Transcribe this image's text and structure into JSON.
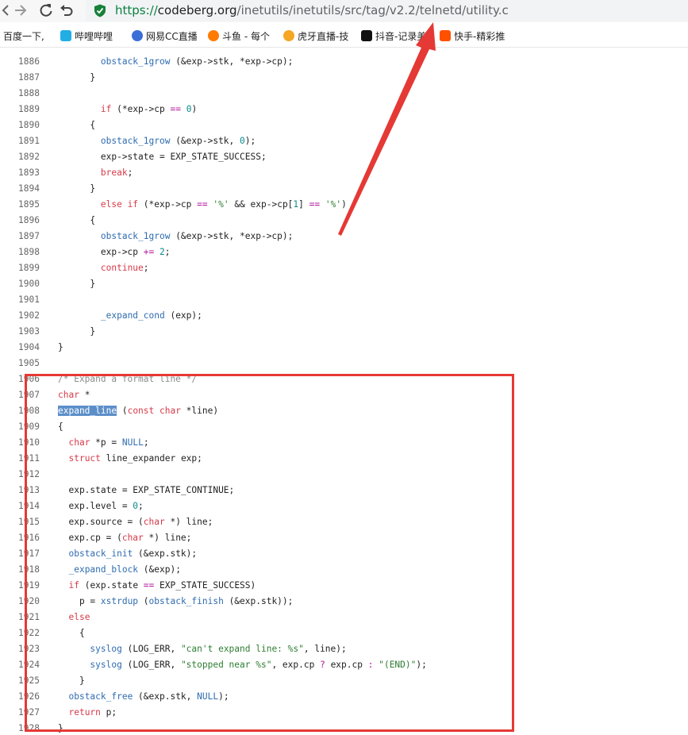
{
  "browser": {
    "url_scheme": "https://",
    "url_host": "codeberg.org",
    "url_path": "/inetutils/inetutils/src/tag/v2.2/telnetd/utility.c"
  },
  "bookmarks": [
    {
      "label": "百度一下,",
      "color": ""
    },
    {
      "label": "哔哩哔哩",
      "color": "#23ade5"
    },
    {
      "label": "网易CC直播",
      "color": "#3b6fd8"
    },
    {
      "label": "斗鱼 - 每个",
      "color": "#ff7a00"
    },
    {
      "label": "虎牙直播-技",
      "color": "#f5a623"
    },
    {
      "label": "抖音-记录美",
      "color": "#111111"
    },
    {
      "label": "快手-精彩推",
      "color": "#ff5000"
    }
  ],
  "code_lines": [
    {
      "n": "1886",
      "tokens": [
        [
          "        "
        ],
        [
          "obstack_1grow",
          "fn"
        ],
        [
          " (&exp->stk, *exp->cp);"
        ]
      ]
    },
    {
      "n": "1887",
      "tokens": [
        [
          "      }"
        ]
      ]
    },
    {
      "n": "1888",
      "tokens": [
        [
          ""
        ]
      ]
    },
    {
      "n": "1889",
      "tokens": [
        [
          "        "
        ],
        [
          "if",
          "kw"
        ],
        [
          " (*exp->cp "
        ],
        [
          "==",
          "op"
        ],
        [
          " "
        ],
        [
          "0",
          "num"
        ],
        [
          ")"
        ]
      ]
    },
    {
      "n": "1890",
      "tokens": [
        [
          "      {"
        ]
      ]
    },
    {
      "n": "1891",
      "tokens": [
        [
          "        "
        ],
        [
          "obstack_1grow",
          "fn"
        ],
        [
          " (&exp->stk, "
        ],
        [
          "0",
          "num"
        ],
        [
          ");"
        ]
      ]
    },
    {
      "n": "1892",
      "tokens": [
        [
          "        exp->state = EXP_STATE_SUCCESS;"
        ]
      ]
    },
    {
      "n": "1893",
      "tokens": [
        [
          "        "
        ],
        [
          "break",
          "kw"
        ],
        [
          ";"
        ]
      ]
    },
    {
      "n": "1894",
      "tokens": [
        [
          "      }"
        ]
      ]
    },
    {
      "n": "1895",
      "tokens": [
        [
          "        "
        ],
        [
          "else if",
          "kw"
        ],
        [
          " (*exp->cp "
        ],
        [
          "==",
          "op"
        ],
        [
          " "
        ],
        [
          "'%'",
          "str"
        ],
        [
          " && exp->cp["
        ],
        [
          "1",
          "num"
        ],
        [
          "] "
        ],
        [
          "==",
          "op"
        ],
        [
          " "
        ],
        [
          "'%'",
          "str"
        ],
        [
          ")"
        ]
      ]
    },
    {
      "n": "1896",
      "tokens": [
        [
          "      {"
        ]
      ]
    },
    {
      "n": "1897",
      "tokens": [
        [
          "        "
        ],
        [
          "obstack_1grow",
          "fn"
        ],
        [
          " (&exp->stk, *exp->cp);"
        ]
      ]
    },
    {
      "n": "1898",
      "tokens": [
        [
          "        exp->cp "
        ],
        [
          "+=",
          "op"
        ],
        [
          " "
        ],
        [
          "2",
          "num"
        ],
        [
          ";"
        ]
      ]
    },
    {
      "n": "1899",
      "tokens": [
        [
          "        "
        ],
        [
          "continue",
          "kw"
        ],
        [
          ";"
        ]
      ]
    },
    {
      "n": "1900",
      "tokens": [
        [
          "      }"
        ]
      ]
    },
    {
      "n": "1901",
      "tokens": [
        [
          ""
        ]
      ]
    },
    {
      "n": "1902",
      "tokens": [
        [
          "        "
        ],
        [
          "_expand_cond",
          "fn"
        ],
        [
          " (exp);"
        ]
      ]
    },
    {
      "n": "1903",
      "tokens": [
        [
          "      }"
        ]
      ]
    },
    {
      "n": "1904",
      "tokens": [
        [
          "}"
        ]
      ]
    },
    {
      "n": "1905",
      "tokens": [
        [
          ""
        ]
      ]
    },
    {
      "n": "1906",
      "tokens": [
        [
          "/* Expand a format line */",
          "cm"
        ]
      ]
    },
    {
      "n": "1907",
      "tokens": [
        [
          "char",
          "kw"
        ],
        [
          " *"
        ]
      ]
    },
    {
      "n": "1908",
      "tokens": [
        [
          "expand_line",
          "hl"
        ],
        [
          " ("
        ],
        [
          "const char",
          "kw"
        ],
        [
          " *line)"
        ]
      ]
    },
    {
      "n": "1909",
      "tokens": [
        [
          "{"
        ]
      ]
    },
    {
      "n": "1910",
      "tokens": [
        [
          "  "
        ],
        [
          "char",
          "kw"
        ],
        [
          " *p = "
        ],
        [
          "NULL",
          "fn"
        ],
        [
          ";"
        ]
      ]
    },
    {
      "n": "1911",
      "tokens": [
        [
          "  "
        ],
        [
          "struct",
          "kw"
        ],
        [
          " line_expander exp;"
        ]
      ]
    },
    {
      "n": "1912",
      "tokens": [
        [
          ""
        ]
      ]
    },
    {
      "n": "1913",
      "tokens": [
        [
          "  exp.state = EXP_STATE_CONTINUE;"
        ]
      ]
    },
    {
      "n": "1914",
      "tokens": [
        [
          "  exp.level = "
        ],
        [
          "0",
          "num"
        ],
        [
          ";"
        ]
      ]
    },
    {
      "n": "1915",
      "tokens": [
        [
          "  exp.source = ("
        ],
        [
          "char",
          "kw"
        ],
        [
          " *) line;"
        ]
      ]
    },
    {
      "n": "1916",
      "tokens": [
        [
          "  exp.cp = ("
        ],
        [
          "char",
          "kw"
        ],
        [
          " *) line;"
        ]
      ]
    },
    {
      "n": "1917",
      "tokens": [
        [
          "  "
        ],
        [
          "obstack_init",
          "fn"
        ],
        [
          " (&exp.stk);"
        ]
      ]
    },
    {
      "n": "1918",
      "tokens": [
        [
          "  "
        ],
        [
          "_expand_block",
          "fn"
        ],
        [
          " (&exp);"
        ]
      ]
    },
    {
      "n": "1919",
      "tokens": [
        [
          "  "
        ],
        [
          "if",
          "kw"
        ],
        [
          " (exp.state "
        ],
        [
          "==",
          "op"
        ],
        [
          " EXP_STATE_SUCCESS)"
        ]
      ]
    },
    {
      "n": "1920",
      "tokens": [
        [
          "    p = "
        ],
        [
          "xstrdup",
          "fn"
        ],
        [
          " ("
        ],
        [
          "obstack_finish",
          "fn"
        ],
        [
          " (&exp.stk));"
        ]
      ]
    },
    {
      "n": "1921",
      "tokens": [
        [
          "  "
        ],
        [
          "else",
          "kw"
        ]
      ]
    },
    {
      "n": "1922",
      "tokens": [
        [
          "    {"
        ]
      ]
    },
    {
      "n": "1923",
      "tokens": [
        [
          "      "
        ],
        [
          "syslog",
          "fn"
        ],
        [
          " (LOG_ERR, "
        ],
        [
          "\"can't expand line: %s\"",
          "str"
        ],
        [
          ", line);"
        ]
      ]
    },
    {
      "n": "1924",
      "tokens": [
        [
          "      "
        ],
        [
          "syslog",
          "fn"
        ],
        [
          " (LOG_ERR, "
        ],
        [
          "\"stopped near %s\"",
          "str"
        ],
        [
          ", exp.cp "
        ],
        [
          "?",
          "op"
        ],
        [
          " exp.cp "
        ],
        [
          ":",
          "op"
        ],
        [
          " "
        ],
        [
          "\"(END)\"",
          "str"
        ],
        [
          ");"
        ]
      ]
    },
    {
      "n": "1925",
      "tokens": [
        [
          "    }"
        ]
      ]
    },
    {
      "n": "1926",
      "tokens": [
        [
          "  "
        ],
        [
          "obstack_free",
          "fn"
        ],
        [
          " (&exp.stk, "
        ],
        [
          "NULL",
          "fn"
        ],
        [
          ");"
        ]
      ]
    },
    {
      "n": "1927",
      "tokens": [
        [
          "  "
        ],
        [
          "return",
          "kw"
        ],
        [
          " p;"
        ]
      ]
    },
    {
      "n": "1928",
      "tokens": [
        [
          "}"
        ]
      ]
    }
  ],
  "colors": {
    "annotation_red": "#e53935",
    "highlight": "#5c8fc9"
  }
}
